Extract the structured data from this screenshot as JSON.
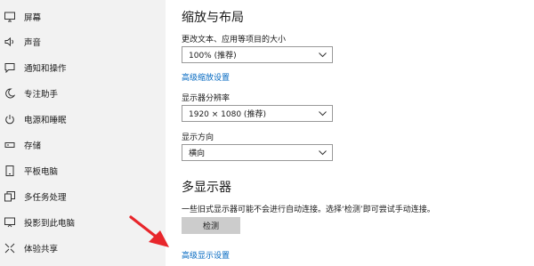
{
  "sidebar": {
    "items": [
      {
        "label": "屏幕",
        "icon": "monitor-icon"
      },
      {
        "label": "声音",
        "icon": "speaker-icon"
      },
      {
        "label": "通知和操作",
        "icon": "message-icon"
      },
      {
        "label": "专注助手",
        "icon": "moon-icon"
      },
      {
        "label": "电源和睡眠",
        "icon": "power-icon"
      },
      {
        "label": "存储",
        "icon": "storage-icon"
      },
      {
        "label": "平板电脑",
        "icon": "tablet-icon"
      },
      {
        "label": "多任务处理",
        "icon": "multitask-icon"
      },
      {
        "label": "投影到此电脑",
        "icon": "project-icon"
      },
      {
        "label": "体验共享",
        "icon": "share-icon"
      }
    ]
  },
  "scale_layout": {
    "title": "缩放与布局",
    "text_size_label": "更改文本、应用等项目的大小",
    "text_size_value": "100% (推荐)",
    "advanced_scaling_link": "高级缩放设置",
    "resolution_label": "显示器分辨率",
    "resolution_value": "1920 × 1080 (推荐)",
    "orientation_label": "显示方向",
    "orientation_value": "横向"
  },
  "multi_display": {
    "title": "多显示器",
    "description": "一些旧式显示器可能不会进行自动连接。选择‘检测’即可尝试手动连接。",
    "detect_button": "检测",
    "advanced_display_link": "高级显示设置"
  },
  "colors": {
    "link": "#0067c0",
    "arrow": "#e8262b",
    "sidebar_bg": "#f2f2f2"
  }
}
